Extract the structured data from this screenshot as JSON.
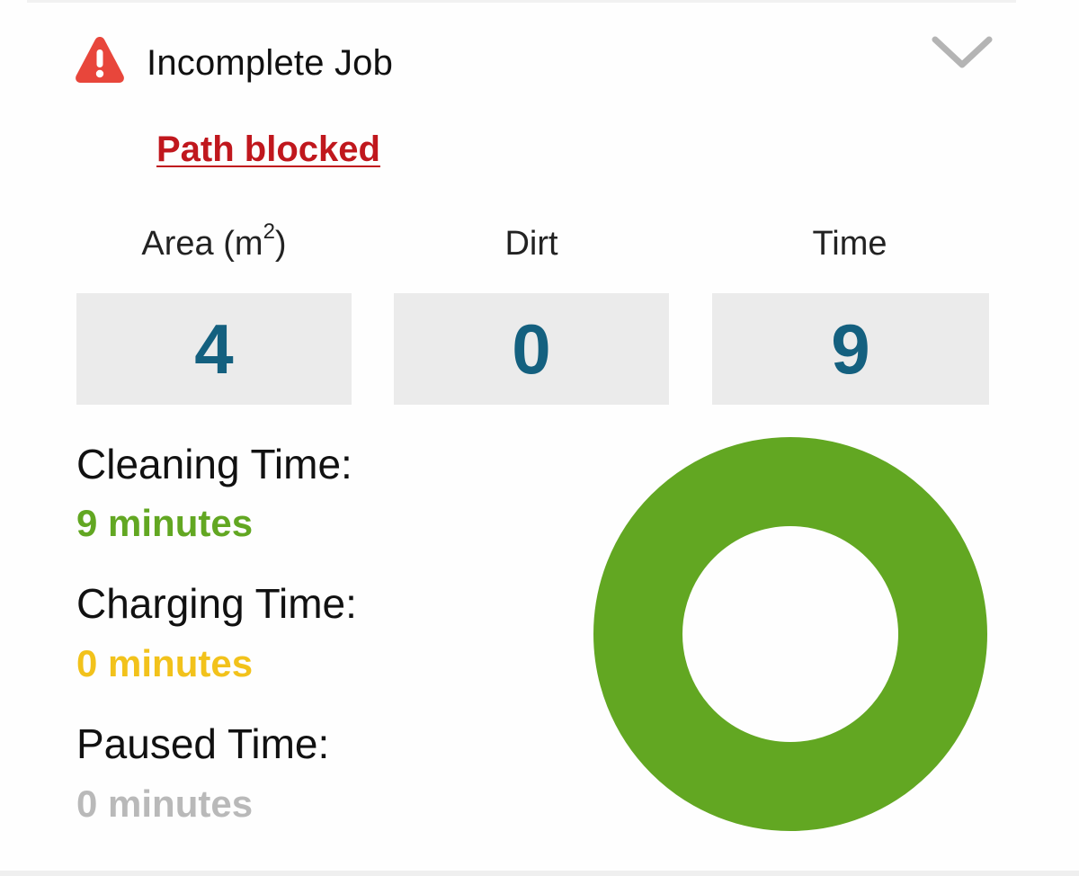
{
  "header": {
    "title": "Incomplete Job",
    "status_icon": "warning-triangle-icon",
    "expand_icon": "chevron-down-icon",
    "error_text": "Path blocked"
  },
  "stats": {
    "area": {
      "label": "Area (m",
      "superscript": "2",
      "label_suffix": ")",
      "value": "4"
    },
    "dirt": {
      "label": "Dirt",
      "value": "0"
    },
    "time": {
      "label": "Time",
      "value": "9"
    }
  },
  "breakdown": {
    "cleaning": {
      "label": "Cleaning Time:",
      "value": "9 minutes",
      "minutes": 9,
      "color": "#62a722"
    },
    "charging": {
      "label": "Charging Time:",
      "value": "0 minutes",
      "minutes": 0,
      "color": "#f2c21b"
    },
    "paused": {
      "label": "Paused Time:",
      "value": "0 minutes",
      "minutes": 0,
      "color": "#b9b9b9"
    }
  },
  "colors": {
    "error": "#c0171d",
    "warning_icon": "#e8463b",
    "stat_value": "#14607f",
    "stat_box": "#ebebeb"
  }
}
